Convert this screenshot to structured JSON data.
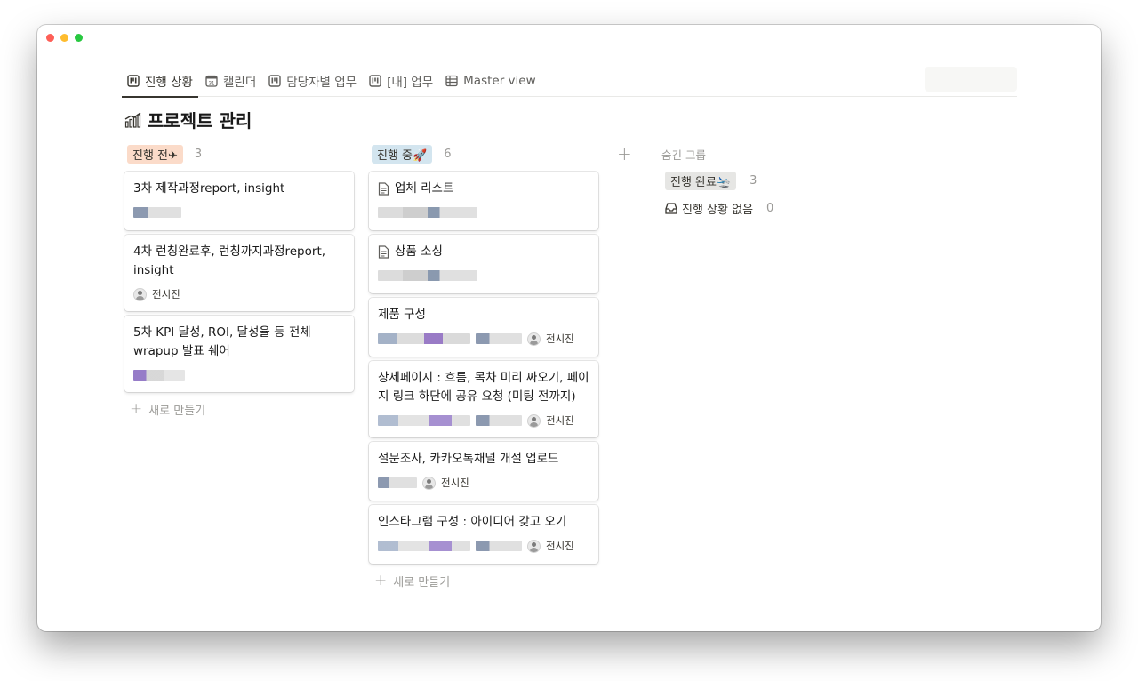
{
  "tabs": [
    {
      "label": "진행 상황",
      "icon": "board-icon",
      "active": true
    },
    {
      "label": "캘린더",
      "icon": "calendar-icon",
      "active": false
    },
    {
      "label": "담당자별 업무",
      "icon": "board-icon",
      "active": false
    },
    {
      "label": "[내] 업무",
      "icon": "board-icon",
      "active": false
    },
    {
      "label": "Master view",
      "icon": "table-icon",
      "active": false
    }
  ],
  "calendar_icon_text": "31",
  "page": {
    "title": "프로젝트 관리",
    "icon": "chart-increasing-icon"
  },
  "columns": [
    {
      "label": "진행 전✈",
      "count": "3",
      "color": "#fbdbc9",
      "cards": [
        {
          "title": "3차 제작과정report, insight"
        },
        {
          "title": "4차 런칭완료후, 런칭까지과정report, insight",
          "person": "전시진"
        },
        {
          "title": "5차 KPI 달성, ROI, 달성율 등 전체 wrapup 발표 쉐어"
        }
      ],
      "new_label": "새로 만들기"
    },
    {
      "label": "진행 중🚀",
      "count": "6",
      "color": "#d3e5ef",
      "cards": [
        {
          "title": "업체 리스트",
          "page_icon": true
        },
        {
          "title": "상품 소싱",
          "page_icon": true
        },
        {
          "title": "제품 구성",
          "person": "전시진"
        },
        {
          "title": "상세페이지 : 흐름, 목차 미리 짜오기, 페이지 링크 하단에 공유 요청 (미팅 전까지)",
          "person": "전시진"
        },
        {
          "title": "설문조사, 카카오톡채널 개설 업로드",
          "person": "전시진"
        },
        {
          "title": "인스타그램 구성 : 아이디어 갖고 오기",
          "person": "전시진"
        }
      ],
      "new_label": "새로 만들기"
    }
  ],
  "add_group_label": "+",
  "hidden_groups": {
    "heading": "숨긴 그룹",
    "items": [
      {
        "label": "진행 완료🛬",
        "count": "3"
      },
      {
        "label": "진행 상황 없음",
        "count": "0",
        "icon": "inbox-icon"
      }
    ]
  }
}
